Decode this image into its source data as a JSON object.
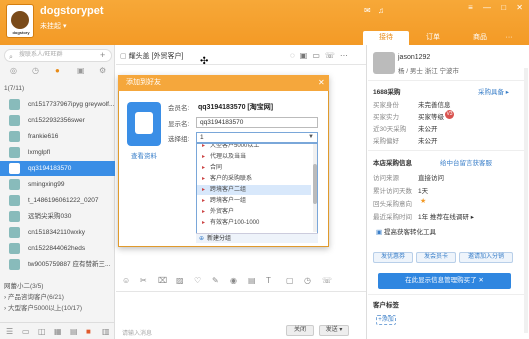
{
  "header": {
    "logo_text": "dogstory",
    "shop_name": "dogstorypet",
    "status": "未挂起 ▾",
    "tabs": [
      {
        "label": "接待"
      },
      {
        "label": "订单"
      },
      {
        "label": "商品"
      },
      {
        "label": "···"
      }
    ],
    "window_controls": "≡ — □ ✕"
  },
  "sidebar": {
    "search_placeholder": "搜联系人/旺旺群",
    "add_label": "+",
    "group_header": "1(7/11)",
    "contacts": [
      {
        "name": "cn1517737967ipyg greywolf..."
      },
      {
        "name": "cn1522932356swer"
      },
      {
        "name": "frankie616"
      },
      {
        "name": "lxmglpfl"
      },
      {
        "name": "qq3194183570",
        "selected": true
      },
      {
        "name": "smingxing99"
      },
      {
        "name": "t_1486196061222_0207"
      },
      {
        "name": "远销尖采购030"
      },
      {
        "name": "cn1518342110wxky"
      },
      {
        "name": "cn1522844062heds"
      },
      {
        "name": "tw9005759887 应有赞新三..."
      }
    ],
    "groups": [
      {
        "label": "网蕾小二(3/5)"
      },
      {
        "label": "› 产品咨询客户(6/21)"
      },
      {
        "label": "› 大型客户5000以上(10/17)"
      }
    ]
  },
  "chat": {
    "title": "耀头盖 [外贸客户]",
    "input_placeholder": "请输入消息",
    "close_label": "关闭",
    "send_label": "发送 ▾"
  },
  "dialog": {
    "title": "添加到好友",
    "member_label": "会员名:",
    "member_value": "qq3194183570 [淘宝网]",
    "display_label": "显示名:",
    "display_value": "qq3194183570",
    "group_label": "选择组:",
    "group_value": "1",
    "view_profile": "查看资料",
    "options": [
      {
        "label": "大型客户5000以上"
      },
      {
        "label": "代理以及当当"
      },
      {
        "label": "合同"
      },
      {
        "label": "客户的采购联系"
      },
      {
        "label": "跨境客户二组",
        "highlighted": true
      },
      {
        "label": "跨境客户一组"
      },
      {
        "label": "外贸客户"
      },
      {
        "label": "有效客户100-1000"
      }
    ],
    "new_group": "新建分组"
  },
  "right": {
    "name": "jason1292",
    "location": "杨 / 男士    浙江 宁波市",
    "purchase_title": "1688采购",
    "purchase_link": "采购具备 ▸",
    "purchase_rows": [
      {
        "label": "买家身份",
        "value": "未完善信息"
      },
      {
        "label": "买家实力",
        "value": "买家等级"
      },
      {
        "label": "近30天采购",
        "value": "未公开"
      },
      {
        "label": "采购偏好",
        "value": "未公开"
      }
    ],
    "badge_text": "V3",
    "store_title": "本店采购信息",
    "store_link": "给中台留言获客服",
    "store_rows": [
      {
        "label": "访问来源",
        "value": "直接访问"
      },
      {
        "label": "累计访问天数",
        "value": "1天"
      },
      {
        "label": "回头采购意向",
        "value": ""
      },
      {
        "label": "最近采购时间",
        "value": "1年 推荐在线调研 ▸"
      }
    ],
    "tools_label": "提高获客转化工具",
    "tool_buttons": [
      {
        "label": "发优惠券"
      },
      {
        "label": "发会员卡"
      },
      {
        "label": "邀请加入分销"
      }
    ],
    "toast": "在此显示信息管理购买了 ✕",
    "tag_title": "客户标签",
    "add_tag": "+添加"
  },
  "colors": {
    "brand_orange": "#f39a26",
    "selected_blue": "#3a8ee6",
    "link_blue": "#3a7fc9"
  }
}
